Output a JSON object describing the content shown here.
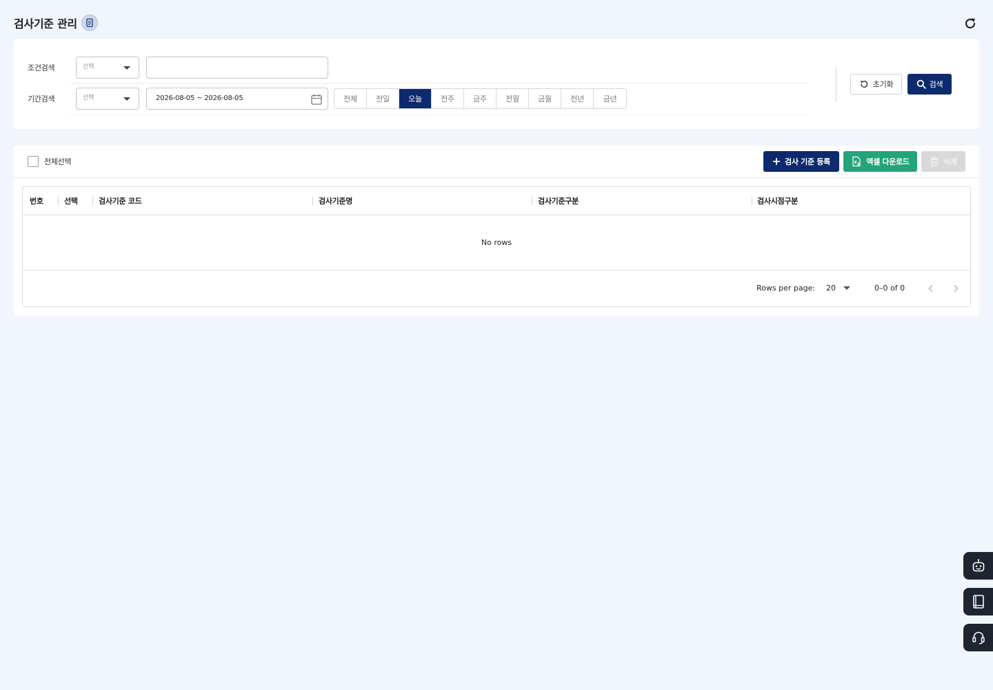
{
  "header": {
    "title": "검사기준 관리"
  },
  "filters": {
    "condition": {
      "label": "조건검색",
      "select_placeholder": "선택",
      "text_value": ""
    },
    "period": {
      "label": "기간검색",
      "select_placeholder": "선택",
      "date_range": "2026-08-05 ~ 2026-08-05",
      "options": [
        "전체",
        "전일",
        "오늘",
        "전주",
        "금주",
        "전월",
        "금월",
        "전년",
        "금년"
      ],
      "active": "오늘"
    },
    "reset_label": "초기화",
    "search_label": "검색"
  },
  "toolbar": {
    "select_all_label": "전체선택",
    "add_label": "검사 기준 등록",
    "excel_label": "엑셀 다운로드",
    "delete_label": "삭제"
  },
  "grid": {
    "columns": [
      "번호",
      "선택",
      "검사기준 코드",
      "검사기준명",
      "검사기준구분",
      "검사시점구분"
    ],
    "empty_text": "No rows",
    "rows_per_page_label": "Rows per page:",
    "rows_per_page": "20",
    "range_text": "0–0 of 0"
  },
  "colors": {
    "primary": "#0d2a6e",
    "excel": "#23a47a",
    "disabled": "#d9d9d9",
    "background": "#f1f5fc",
    "fab": "#1e2430"
  },
  "floating_buttons": [
    "chatbot-icon",
    "manual-book-icon",
    "support-headset-icon"
  ]
}
